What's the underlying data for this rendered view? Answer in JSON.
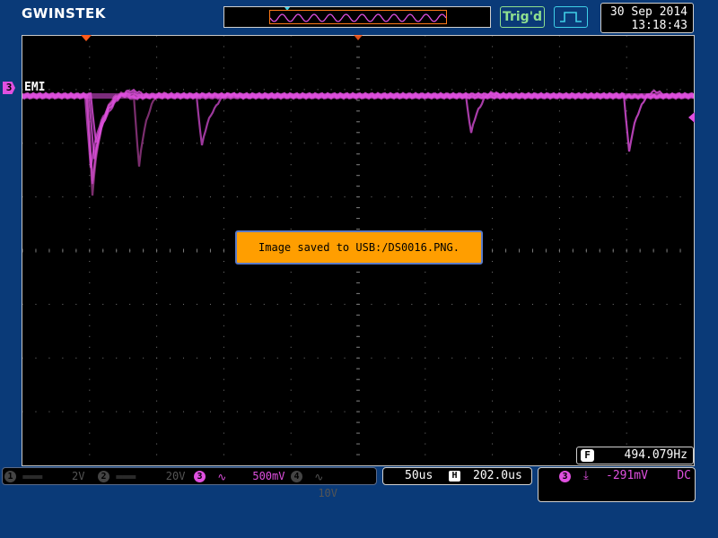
{
  "header": {
    "logo": "GWINSTEK",
    "trigger_status": "Trig'd",
    "trigger_mode_icon": "pulse-icon",
    "date": "30 Sep 2014",
    "time": "13:18:43"
  },
  "colors": {
    "background": "#0a3a78",
    "screen": "#000000",
    "grid": "#7a7a7a",
    "ch3_trace": "#e050e0",
    "ch3_trace_dim": "#9a3a8a",
    "accent_orange": "#ff9e00",
    "trig_green": "#8fe08f",
    "cyan": "#3fd0e8"
  },
  "waveform": {
    "channel_label": "EMI",
    "channel_number": "3"
  },
  "message": {
    "text": "Image saved to USB:/DS0016.PNG."
  },
  "frequency": {
    "icon": "F",
    "value": "494.079Hz"
  },
  "channels": [
    {
      "number": "1",
      "coupling": "═══",
      "scale": "2V",
      "state": "off"
    },
    {
      "number": "2",
      "coupling": "═══",
      "scale": "20V",
      "state": "off"
    },
    {
      "number": "3",
      "coupling": "∿",
      "scale": "500mV",
      "state": "on"
    },
    {
      "number": "4",
      "coupling": "∿",
      "scale": "10V",
      "state": "off"
    }
  ],
  "timebase": {
    "scale": "50us",
    "position_icon": "H",
    "position": "202.0us"
  },
  "trigger": {
    "source": "3",
    "slope": "⤓",
    "level": "-291mV",
    "coupling": "DC"
  }
}
